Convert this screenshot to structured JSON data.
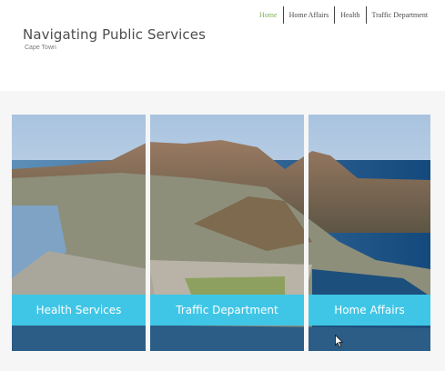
{
  "site": {
    "title": "Navigating Public Services",
    "subtitle": "Cape Town"
  },
  "nav": {
    "items": [
      {
        "label": "Home",
        "active": true
      },
      {
        "label": "Home Affairs",
        "active": false
      },
      {
        "label": "Health",
        "active": false
      },
      {
        "label": "Traffic Department",
        "active": false
      }
    ]
  },
  "panels": {
    "health": {
      "label": "Health Services"
    },
    "traffic": {
      "label": "Traffic Department"
    },
    "home_affairs": {
      "label": "Home Affairs"
    }
  },
  "colors": {
    "accent_green": "#7ab35a",
    "label_cyan": "#3fc6e6"
  }
}
